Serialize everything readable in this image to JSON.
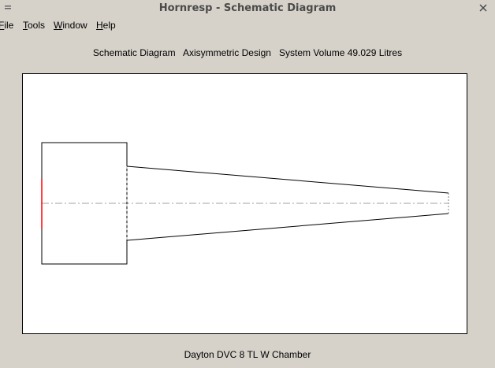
{
  "window": {
    "title": "Hornresp - Schematic Diagram"
  },
  "menu": {
    "items": [
      {
        "accel": "F",
        "rest": "ile"
      },
      {
        "accel": "T",
        "rest": "ools"
      },
      {
        "accel": "W",
        "rest": "indow"
      },
      {
        "accel": "H",
        "rest": "elp"
      }
    ]
  },
  "header": {
    "diagram_label": "Schematic Diagram",
    "design_label": "Axisymmetric Design",
    "volume_label": "System Volume 49.029 Litres"
  },
  "footer": {
    "record_title": "Dayton DVC 8 TL W Chamber"
  },
  "colors": {
    "outline": "#000000",
    "driver": "#ff0000",
    "axis": "#a0a0a0"
  },
  "icons": {
    "system_menu": "window-menu-icon",
    "close": "close-icon"
  }
}
